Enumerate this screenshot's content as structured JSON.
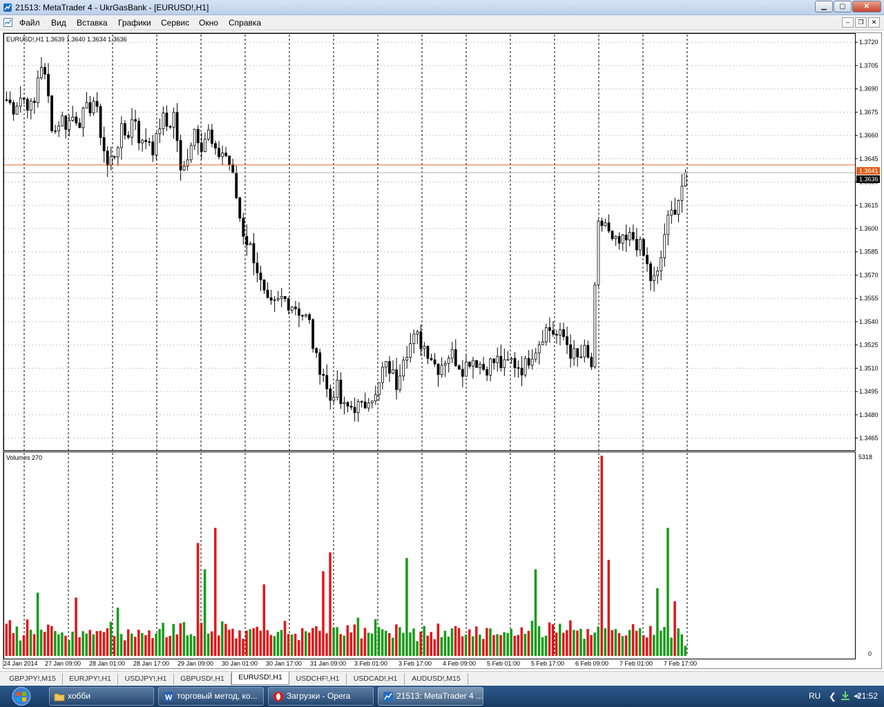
{
  "window": {
    "title": "21513: MetaTrader 4 - UkrGasBank - [EURUSD!,H1]",
    "minimize_label": "▁",
    "maximize_label": "▢",
    "close_label": "✕"
  },
  "menu": {
    "items": [
      "Файл",
      "Вид",
      "Вставка",
      "Графики",
      "Сервис",
      "Окно",
      "Справка"
    ],
    "mdi_minimize": "–",
    "mdi_restore": "❐",
    "mdi_close": "✕"
  },
  "chart": {
    "header": "EURUSD!,H1  1.3639 1.3640 1.3634 1.3636",
    "volume_header": "Volumes 270",
    "colors": {
      "candle": "#000000",
      "bid_line": "#e0601c",
      "ask_line": "#b0b0b0",
      "volume_up": "#1a9a1a",
      "volume_down": "#e01818",
      "grid": "#000000"
    }
  },
  "chart_data": [
    {
      "type": "candlestick",
      "symbol": "EURUSD!",
      "timeframe": "H1",
      "y_ticks": [
        "1.3720",
        "1.3705",
        "1.3690",
        "1.3675",
        "1.3660",
        "1.3645",
        "1.3630",
        "1.3615",
        "1.3600",
        "1.3585",
        "1.3570",
        "1.3555",
        "1.3540",
        "1.3525",
        "1.3510",
        "1.3495",
        "1.3480",
        "1.3465"
      ],
      "ylim": [
        1.3459,
        1.3725
      ],
      "x_ticks": [
        "24 Jan 2014",
        "27 Jan 09:00",
        "28 Jan 01:00",
        "28 Jan 17:00",
        "29 Jan 09:00",
        "30 Jan 01:00",
        "30 Jan 17:00",
        "31 Jan 09:00",
        "3 Feb 01:00",
        "3 Feb 17:00",
        "4 Feb 09:00",
        "5 Feb 01:00",
        "5 Feb 17:00",
        "6 Feb 09:00",
        "7 Feb 01:00",
        "7 Feb 17:00"
      ],
      "last_bar": {
        "open": 1.3639,
        "high": 1.364,
        "low": 1.3634,
        "close": 1.3636
      },
      "price_labels": {
        "bid": "1.3641",
        "ask": "1.3636"
      },
      "path": [
        1.3683,
        1.3678,
        1.3685,
        1.3682,
        1.3675,
        1.371,
        1.369,
        1.366,
        1.3672,
        1.3667,
        1.3673,
        1.367,
        1.3676,
        1.3683,
        1.3662,
        1.364,
        1.3648,
        1.3662,
        1.366,
        1.3675,
        1.3652,
        1.366,
        1.365,
        1.3672,
        1.3665,
        1.3675,
        1.363,
        1.365,
        1.3665,
        1.3655,
        1.3662,
        1.3646,
        1.365,
        1.3645,
        1.3625,
        1.36,
        1.359,
        1.358,
        1.356,
        1.3548,
        1.355,
        1.3555,
        1.3553,
        1.355,
        1.3545,
        1.354,
        1.3515,
        1.351,
        1.3488,
        1.35,
        1.3483,
        1.3485,
        1.3486,
        1.3483,
        1.3495,
        1.349,
        1.351,
        1.351,
        1.35,
        1.352,
        1.3525,
        1.353,
        1.3525,
        1.352,
        1.351,
        1.3515,
        1.352,
        1.3515,
        1.351,
        1.3517,
        1.3515,
        1.351,
        1.3513,
        1.3515,
        1.351,
        1.3515,
        1.3512,
        1.351,
        1.352,
        1.3525,
        1.3535,
        1.3535,
        1.353,
        1.353,
        1.352,
        1.3515,
        1.352,
        1.351,
        1.36,
        1.3605,
        1.359,
        1.359,
        1.359,
        1.3595,
        1.359,
        1.358,
        1.3565,
        1.357,
        1.36,
        1.361,
        1.362,
        1.3636
      ],
      "volume": {
        "label": "Volumes",
        "ylim": [
          0,
          5318
        ],
        "y_ticks": [
          "5318",
          "0"
        ],
        "pattern": [
          12,
          16,
          8,
          10,
          7,
          9,
          14,
          12,
          10,
          11,
          9,
          8,
          13,
          12,
          9,
          10,
          8,
          9,
          7,
          8,
          10,
          9,
          11,
          8,
          12,
          9,
          10,
          8,
          9,
          11,
          13,
          8,
          9,
          10,
          7,
          12,
          9,
          8,
          10,
          11,
          9,
          8,
          7,
          9,
          10,
          12,
          8,
          9,
          11,
          10
        ],
        "spikes": [
          {
            "x": 0.045,
            "v": 1680
          },
          {
            "x": 0.105,
            "v": 1550
          },
          {
            "x": 0.165,
            "v": 1280
          },
          {
            "x": 0.28,
            "v": 3000
          },
          {
            "x": 0.29,
            "v": 2300
          },
          {
            "x": 0.31,
            "v": 3400
          },
          {
            "x": 0.38,
            "v": 1900
          },
          {
            "x": 0.465,
            "v": 2250
          },
          {
            "x": 0.475,
            "v": 2750
          },
          {
            "x": 0.59,
            "v": 2600
          },
          {
            "x": 0.78,
            "v": 2300
          },
          {
            "x": 0.875,
            "v": 5318
          },
          {
            "x": 0.885,
            "v": 2550
          },
          {
            "x": 0.96,
            "v": 1800
          },
          {
            "x": 0.975,
            "v": 3400
          },
          {
            "x": 0.985,
            "v": 1450
          }
        ]
      }
    }
  ],
  "symbol_tabs": [
    "GBPJPY!,M15",
    "EURJPY!,H1",
    "USDJPY!,H1",
    "GBPUSD!,H1",
    "EURUSD!,H1",
    "USDCHF!,H1",
    "USDCAD!,H1",
    "AUDUSD!,M15"
  ],
  "active_tab": "EURUSD!,H1",
  "taskbar": {
    "tasks": [
      "хобби",
      "торговый метод, ко...",
      "Загрузки - Opera",
      "21513: MetaTrader 4 ..."
    ],
    "language": "RU",
    "clock": "21:52"
  }
}
